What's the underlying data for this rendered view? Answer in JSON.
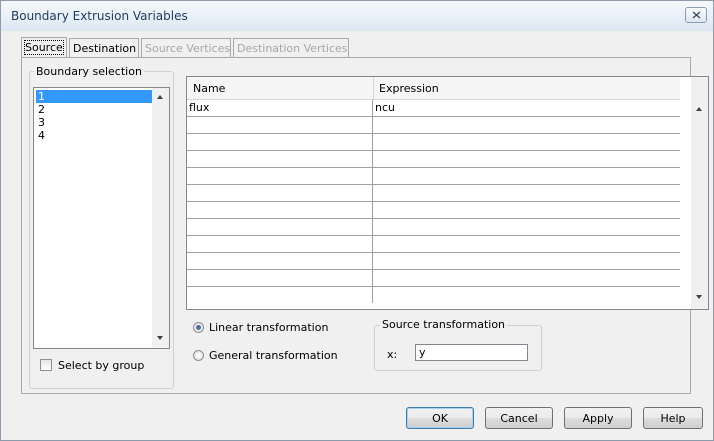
{
  "window": {
    "title": "Boundary Extrusion Variables"
  },
  "tabs": [
    {
      "label": "Source",
      "state": "active"
    },
    {
      "label": "Destination",
      "state": "normal"
    },
    {
      "label": "Source Vertices",
      "state": "disabled"
    },
    {
      "label": "Destination Vertices",
      "state": "disabled"
    }
  ],
  "boundary_selection": {
    "title": "Boundary selection",
    "items": [
      "1",
      "2",
      "3",
      "4"
    ],
    "selected": "1"
  },
  "select_by_group": {
    "label": "Select by group",
    "checked": false
  },
  "variables_table": {
    "columns": [
      "Name",
      "Expression"
    ],
    "rows": [
      {
        "name": "flux",
        "expression": "ncu"
      },
      {
        "name": "",
        "expression": ""
      },
      {
        "name": "",
        "expression": ""
      },
      {
        "name": "",
        "expression": ""
      },
      {
        "name": "",
        "expression": ""
      },
      {
        "name": "",
        "expression": ""
      },
      {
        "name": "",
        "expression": ""
      },
      {
        "name": "",
        "expression": ""
      },
      {
        "name": "",
        "expression": ""
      },
      {
        "name": "",
        "expression": ""
      },
      {
        "name": "",
        "expression": ""
      },
      {
        "name": "",
        "expression": ""
      }
    ]
  },
  "transformation": {
    "linear_label": "Linear transformation",
    "general_label": "General transformation",
    "selected": "linear"
  },
  "source_transformation": {
    "title": "Source transformation",
    "x_label": "x:",
    "x_value": "y"
  },
  "buttons": {
    "ok": "OK",
    "cancel": "Cancel",
    "apply": "Apply",
    "help": "Help"
  },
  "colors": {
    "selection": "#3399ff",
    "title_text": "#1e3c5e"
  }
}
